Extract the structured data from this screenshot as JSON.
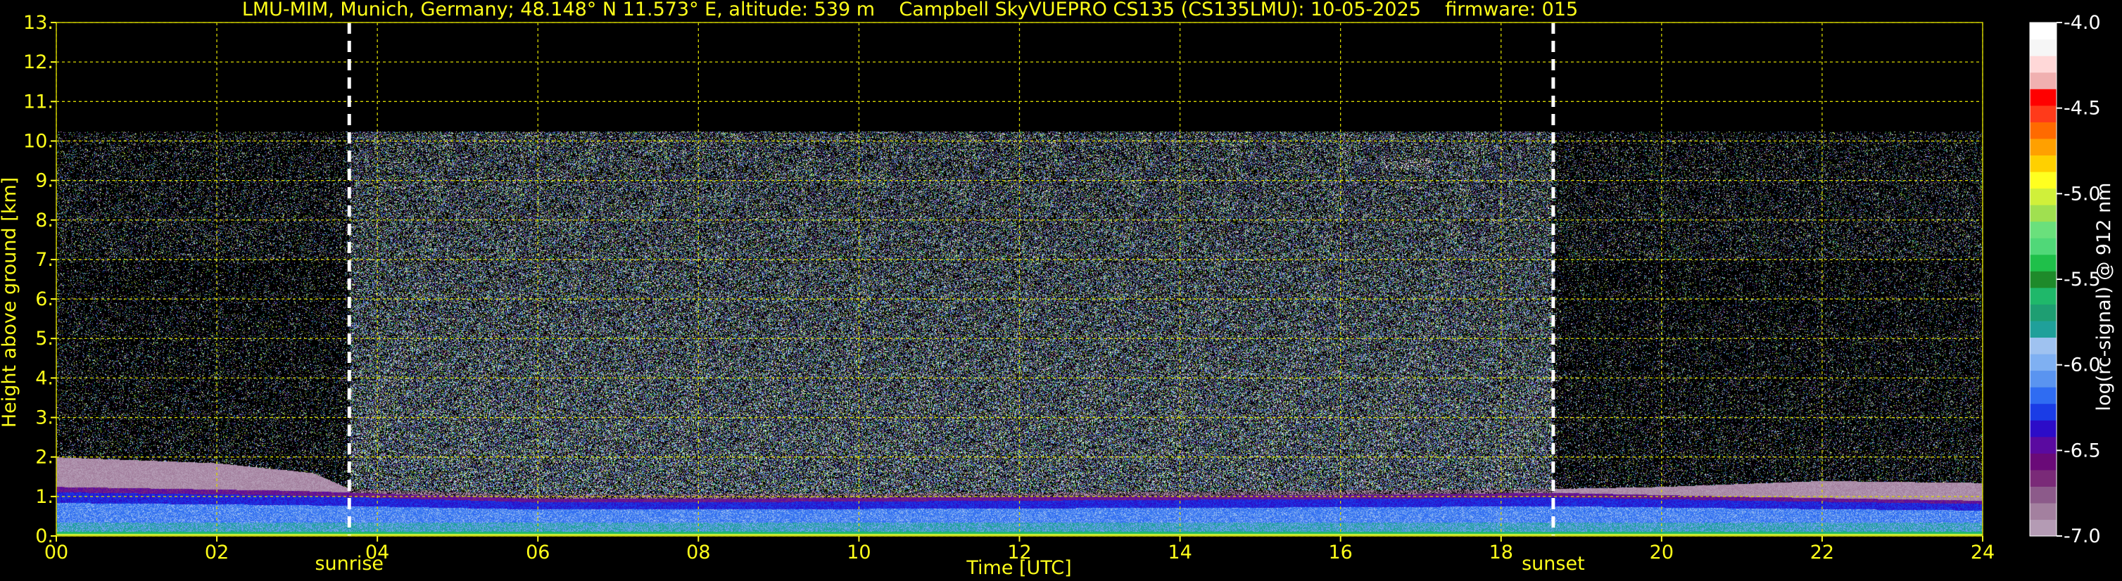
{
  "chart_data": {
    "type": "heatmap",
    "title": "LMU-MIM, Munich, Germany; 48.148° N 11.573° E, altitude: 539 m    Campbell SkyVUEPRO CS135 (CS135LMU): 10-05-2025    firmware: 015",
    "xlabel": "Time [UTC]",
    "ylabel": "Height above ground [km]",
    "x_ticks": [
      "00",
      "02",
      "04",
      "06",
      "08",
      "10",
      "12",
      "14",
      "16",
      "18",
      "20",
      "22",
      "24"
    ],
    "y_ticks": [
      "0.",
      "1.",
      "2.",
      "3.",
      "4.",
      "5.",
      "6.",
      "7.",
      "8.",
      "9.",
      "10.",
      "11.",
      "12.",
      "13."
    ],
    "xlim": [
      0,
      24
    ],
    "ylim": [
      0,
      13
    ],
    "grid": true,
    "colorbar": {
      "label": "log(rc-signal) @ 912 nm",
      "ticks": [
        "-4.0",
        "-4.5",
        "-5.0",
        "-5.5",
        "-6.0",
        "-6.5",
        "-7.0"
      ],
      "range": [
        -7.0,
        -4.0
      ],
      "colors": [
        "#b49bb4",
        "#a3809f",
        "#8c5a8a",
        "#7a2a78",
        "#6a0a78",
        "#5a0aa0",
        "#2c0cc8",
        "#1a3ce6",
        "#2f6cf2",
        "#5a94f0",
        "#7fb0f2",
        "#9fc2f0",
        "#1fa09a",
        "#1e9e72",
        "#1fb86a",
        "#1e8a2a",
        "#1fc04a",
        "#50d878",
        "#6ae07c",
        "#a0e050",
        "#d0f03a",
        "#ffff20",
        "#ffd000",
        "#ffa000",
        "#ff6a00",
        "#ff3a1a",
        "#ff0000",
        "#f0b0b0",
        "#ffd8d8",
        "#f6f6f6",
        "#ffffff"
      ]
    },
    "markers": [
      {
        "label": "sunrise",
        "time": 3.65
      },
      {
        "label": "sunset",
        "time": 18.65
      }
    ],
    "layers": {
      "noise_top_km": 10.25,
      "residual_layer_top_km": [
        {
          "t": 0,
          "h": 2.0
        },
        {
          "t": 2,
          "h": 1.85
        },
        {
          "t": 3.2,
          "h": 1.6
        },
        {
          "t": 3.65,
          "h": 1.2
        },
        {
          "t": 6,
          "h": 1.05
        },
        {
          "t": 12,
          "h": 1.1
        },
        {
          "t": 18.65,
          "h": 1.2
        },
        {
          "t": 20,
          "h": 1.25
        },
        {
          "t": 22,
          "h": 1.4
        },
        {
          "t": 24,
          "h": 1.35
        }
      ],
      "boundary_layer_top_km": [
        {
          "t": 0,
          "h": 1.25
        },
        {
          "t": 3,
          "h": 1.15
        },
        {
          "t": 6,
          "h": 0.95
        },
        {
          "t": 8,
          "h": 0.95
        },
        {
          "t": 12,
          "h": 1.0
        },
        {
          "t": 16,
          "h": 1.05
        },
        {
          "t": 18.65,
          "h": 1.1
        },
        {
          "t": 21,
          "h": 1.0
        },
        {
          "t": 24,
          "h": 0.9
        }
      ],
      "cloud_patch": {
        "t": 16.85,
        "h": 9.4,
        "label": ""
      }
    }
  }
}
